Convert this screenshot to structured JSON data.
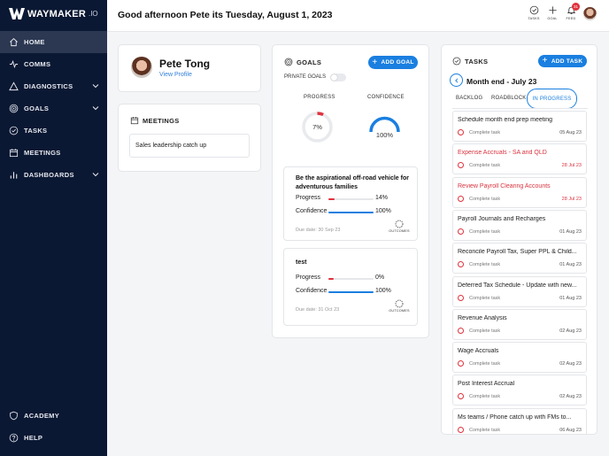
{
  "brand": {
    "name": "WAYMAKER",
    "tld": ".IO"
  },
  "sidebar": {
    "items": [
      {
        "label": "HOME",
        "icon": "home-icon",
        "active": true
      },
      {
        "label": "COMMS",
        "icon": "activity-icon"
      },
      {
        "label": "DIAGNOSTICS",
        "icon": "triangle-icon",
        "expandable": true
      },
      {
        "label": "GOALS",
        "icon": "target-icon",
        "expandable": true
      },
      {
        "label": "TASKS",
        "icon": "check-circle-icon"
      },
      {
        "label": "MEETINGS",
        "icon": "calendar-icon"
      },
      {
        "label": "DASHBOARDS",
        "icon": "bar-chart-icon",
        "expandable": true
      }
    ],
    "bottom": [
      {
        "label": "ACADEMY",
        "icon": "shield-icon"
      },
      {
        "label": "HELP",
        "icon": "help-icon"
      }
    ]
  },
  "header": {
    "greeting": "Good afternoon Pete its Tuesday, August 1, 2023",
    "actions": {
      "tasks": "TASKS",
      "goal": "GOAL",
      "feed": "FEED"
    },
    "feed_badge": "31"
  },
  "profile": {
    "name": "Pete Tong",
    "link": "View Profile"
  },
  "meetings": {
    "title": "MEETINGS",
    "items": [
      "Sales leadership catch up"
    ]
  },
  "goals": {
    "title": "GOALS",
    "add_label": "ADD GOAL",
    "private_label": "PRIVATE GOALS",
    "progress_label": "PROGRESS",
    "confidence_label": "CONFIDENCE",
    "progress_value": "7%",
    "progress_fraction": 0.07,
    "confidence_value": "100%",
    "confidence_fraction": 1.0,
    "progress_metric": "Progress",
    "confidence_metric": "Confidence",
    "outcomes_label": "OUTCOMES",
    "items": [
      {
        "title": "Be the aspirational off-road vehicle for adventurous families",
        "progress": "14%",
        "progress_fraction": 0.14,
        "confidence": "100%",
        "confidence_fraction": 1.0,
        "due": "Due date: 30 Sep 23"
      },
      {
        "title": "test",
        "progress": "0%",
        "progress_fraction": 0.0,
        "confidence": "100%",
        "confidence_fraction": 1.0,
        "due": "Due date: 31 Oct 23"
      }
    ]
  },
  "tasks": {
    "title": "TASKS",
    "add_label": "ADD TASK",
    "list_title": "Month end - July 23",
    "tabs": [
      "BACKLOG",
      "ROADBLOCK",
      "IN PROGRESS"
    ],
    "active_tab": "IN PROGRESS",
    "complete_label": "Complete task",
    "items": [
      {
        "name": "Schedule month end prep meeting",
        "date": "05 Aug 23",
        "overdue": false
      },
      {
        "name": "Expense Accruals - SA and QLD",
        "date": "28 Jul 23",
        "overdue": true
      },
      {
        "name": "Review Payroll Clearing Accounts",
        "date": "28 Jul 23",
        "overdue": true
      },
      {
        "name": "Payroll Journals and Recharges",
        "date": "01 Aug 23",
        "overdue": false
      },
      {
        "name": "Reconcile Payroll Tax, Super PPL & Child...",
        "date": "01 Aug 23",
        "overdue": false
      },
      {
        "name": "Deferred Tax Schedule - Update with new...",
        "date": "01 Aug 23",
        "overdue": false
      },
      {
        "name": "Revenue Analysis",
        "date": "02 Aug 23",
        "overdue": false
      },
      {
        "name": "Wage Accruals",
        "date": "02 Aug 23",
        "overdue": false
      },
      {
        "name": "Post Interest Accrual",
        "date": "02 Aug 23",
        "overdue": false
      },
      {
        "name": "Ms teams / Phone catch up with FMs to...",
        "date": "06 Aug 23",
        "overdue": false
      }
    ]
  },
  "colors": {
    "sidebar": "#0b1833",
    "accent": "#1a7fe0",
    "danger": "#e0323c"
  }
}
